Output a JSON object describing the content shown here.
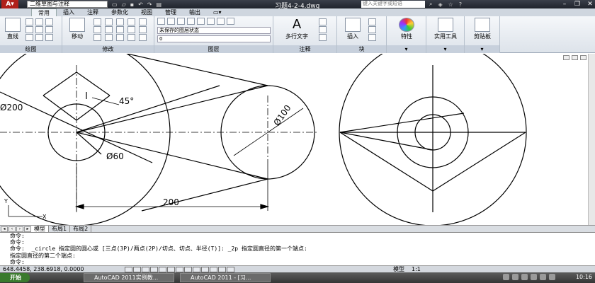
{
  "title_bar": {
    "workspace": "二维草图与注释",
    "doc_title": "习题4-2-4.dwg",
    "search_placeholder": "键入关键字或短语"
  },
  "ribbon_tabs": [
    "常用",
    "插入",
    "注释",
    "参数化",
    "视图",
    "管理",
    "输出"
  ],
  "ribbon": {
    "draw": {
      "line_label": "直线",
      "panel_label": "绘图"
    },
    "modify": {
      "move_label": "移动",
      "panel_label": "修改"
    },
    "layers": {
      "layer_state": "未保存的图层状态",
      "current_layer": "0",
      "panel_label": "图层"
    },
    "annotation": {
      "mtext_label": "多行文字",
      "panel_label": "注释"
    },
    "block": {
      "insert_label": "插入",
      "panel_label": "块"
    },
    "properties_label": "特性",
    "utilities_label": "实用工具",
    "clipboard_label": "剪贴板"
  },
  "drawing": {
    "dim_d200": "Ø200",
    "dim_d100": "Ø100",
    "dim_d60": "Ø60",
    "dim_angle": "45°",
    "dim_len": "200",
    "ucs_x": "X",
    "ucs_y": "Y"
  },
  "layout_tabs": [
    "模型",
    "布局1",
    "布局2"
  ],
  "command_lines": [
    "命令:",
    "命令:",
    "命令:  _circle 指定圆的圆心或 [三点(3P)/两点(2P)/切点、切点、半径(T)]: _2p 指定圆直径的第一个端点:",
    "指定圆直径的第二个端点:",
    "命令:"
  ],
  "status_bar": {
    "coordinates": "648.4458,  238.6918, 0.0000",
    "model_label": "模型",
    "scale": "1:1"
  },
  "taskbar": {
    "start_label": "开始",
    "tasks": [
      "AutoCAD 2011实例教...",
      "AutoCAD 2011 - [习..."
    ],
    "clock": "10:16"
  }
}
